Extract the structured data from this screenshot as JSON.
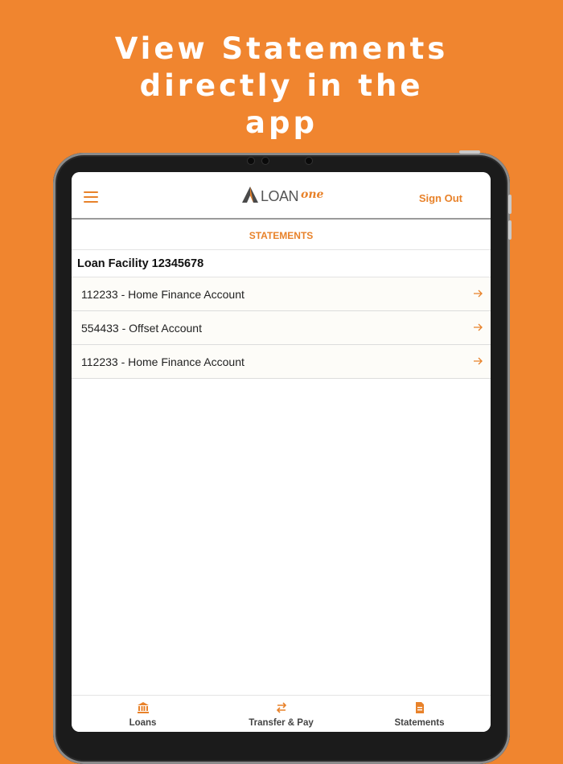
{
  "headline": {
    "line1": "View Statements",
    "line2": "directly in the",
    "line3": "app"
  },
  "header": {
    "logo_text": "LOAN",
    "logo_accent": "one",
    "sign_out": "Sign Out"
  },
  "page": {
    "section_title": "STATEMENTS",
    "facility_title": "Loan Facility 12345678"
  },
  "accounts": [
    {
      "label": "112233 - Home Finance Account"
    },
    {
      "label": "554433 - Offset Account"
    },
    {
      "label": "112233 - Home Finance Account"
    }
  ],
  "tabs": [
    {
      "label": "Loans",
      "icon": "bank-icon"
    },
    {
      "label": "Transfer & Pay",
      "icon": "transfer-icon"
    },
    {
      "label": "Statements",
      "icon": "document-icon"
    }
  ],
  "colors": {
    "background": "#F0852F",
    "accent": "#E8822A"
  }
}
